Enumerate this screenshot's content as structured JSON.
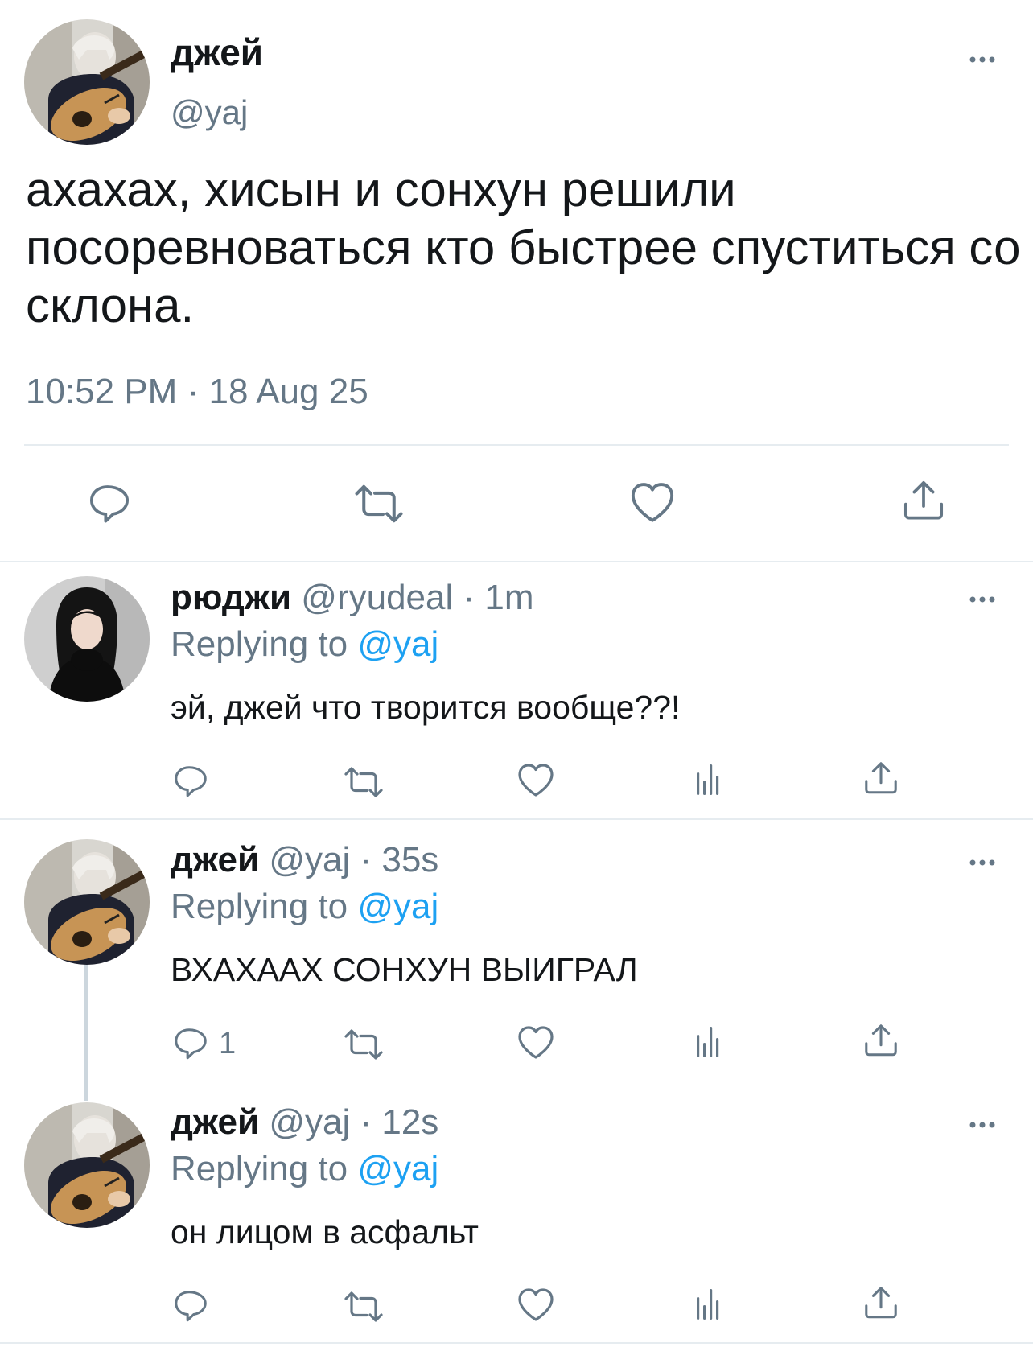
{
  "main_tweet": {
    "name": "джей",
    "handle": "@yaj",
    "text": "ахахах, хисын и сонхун решили посоревноваться кто быстрее спуститься со склона.",
    "time": "10:52 PM",
    "separator": "·",
    "date": "18 Aug 25",
    "more_icon": "ellipsis-icon",
    "actions": [
      "reply-icon",
      "retweet-icon",
      "like-icon",
      "share-icon"
    ]
  },
  "replies": [
    {
      "name": "рюджи",
      "handle": "@ryudeal",
      "time": "· 1m",
      "replying_prefix": "Replying to",
      "replying_to": "@yaj",
      "text": "эй, джей что творится вообще??!",
      "reply_count": ""
    },
    {
      "name": "джей",
      "handle": "@yaj",
      "time": "· 35s",
      "replying_prefix": "Replying to",
      "replying_to": "@yaj",
      "text": "ВХАХААХ СОНХУН ВЫИГРАЛ",
      "reply_count": "1"
    },
    {
      "name": "джей",
      "handle": "@yaj",
      "time": "· 12s",
      "replying_prefix": "Replying to",
      "replying_to": "@yaj",
      "text": "он лицом в асфальт",
      "reply_count": ""
    }
  ],
  "colors": {
    "text": "#14171a",
    "secondary": "#657786",
    "accent": "#1da1f2",
    "divider": "#e6ecf0"
  }
}
